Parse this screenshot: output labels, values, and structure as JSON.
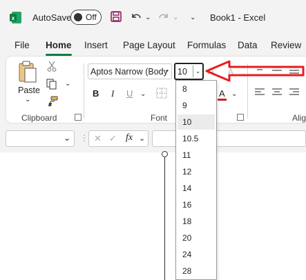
{
  "titlebar": {
    "autosave_label": "AutoSave",
    "autosave_state": "Off",
    "doc_title": "Book1  -  Excel"
  },
  "tabs": [
    "File",
    "Home",
    "Insert",
    "Page Layout",
    "Formulas",
    "Data",
    "Review"
  ],
  "clipboard": {
    "paste_label": "Paste",
    "group_label": "Clipboard"
  },
  "font": {
    "font_name": "Aptos Narrow (Body",
    "font_size": "10",
    "group_label": "Font",
    "bold": "B",
    "italic": "I",
    "underline": "U",
    "font_color_letter": "A",
    "grow_letter": "A",
    "shrink_letter": "A"
  },
  "alignment": {
    "group_label": "Alig"
  },
  "formula_bar": {
    "fx_label": "fx",
    "cancel_symbol": "✕",
    "enter_symbol": "✓"
  },
  "size_list": [
    "8",
    "9",
    "10",
    "10.5",
    "11",
    "12",
    "14",
    "16",
    "18",
    "20",
    "24",
    "28"
  ],
  "size_list_selected": "10",
  "colors": {
    "accent": "#107c41",
    "annotation_arrow": "#e81c1c",
    "font_color": "#d11b1b"
  }
}
